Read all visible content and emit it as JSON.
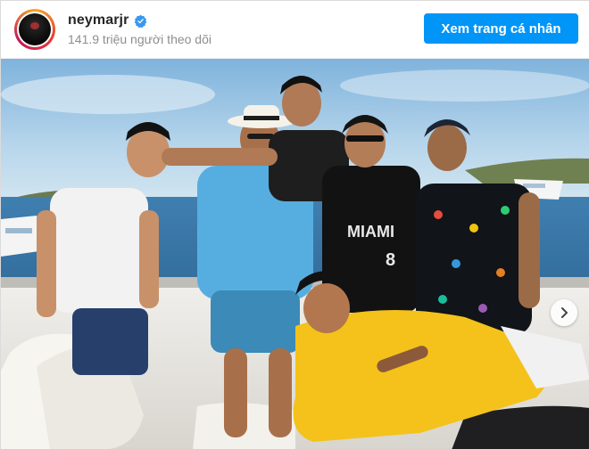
{
  "profile": {
    "username": "neymarjr",
    "followers_text": "141.9 triệu người theo dõi",
    "verified": true,
    "verified_color": "#3897f0"
  },
  "actions": {
    "view_profile_label": "Xem trang cá nhân",
    "button_color": "#0095f6"
  },
  "post": {
    "jersey_text": "MIAMI",
    "jersey_number": "8",
    "carousel_next_icon": "chevron-right-icon"
  }
}
